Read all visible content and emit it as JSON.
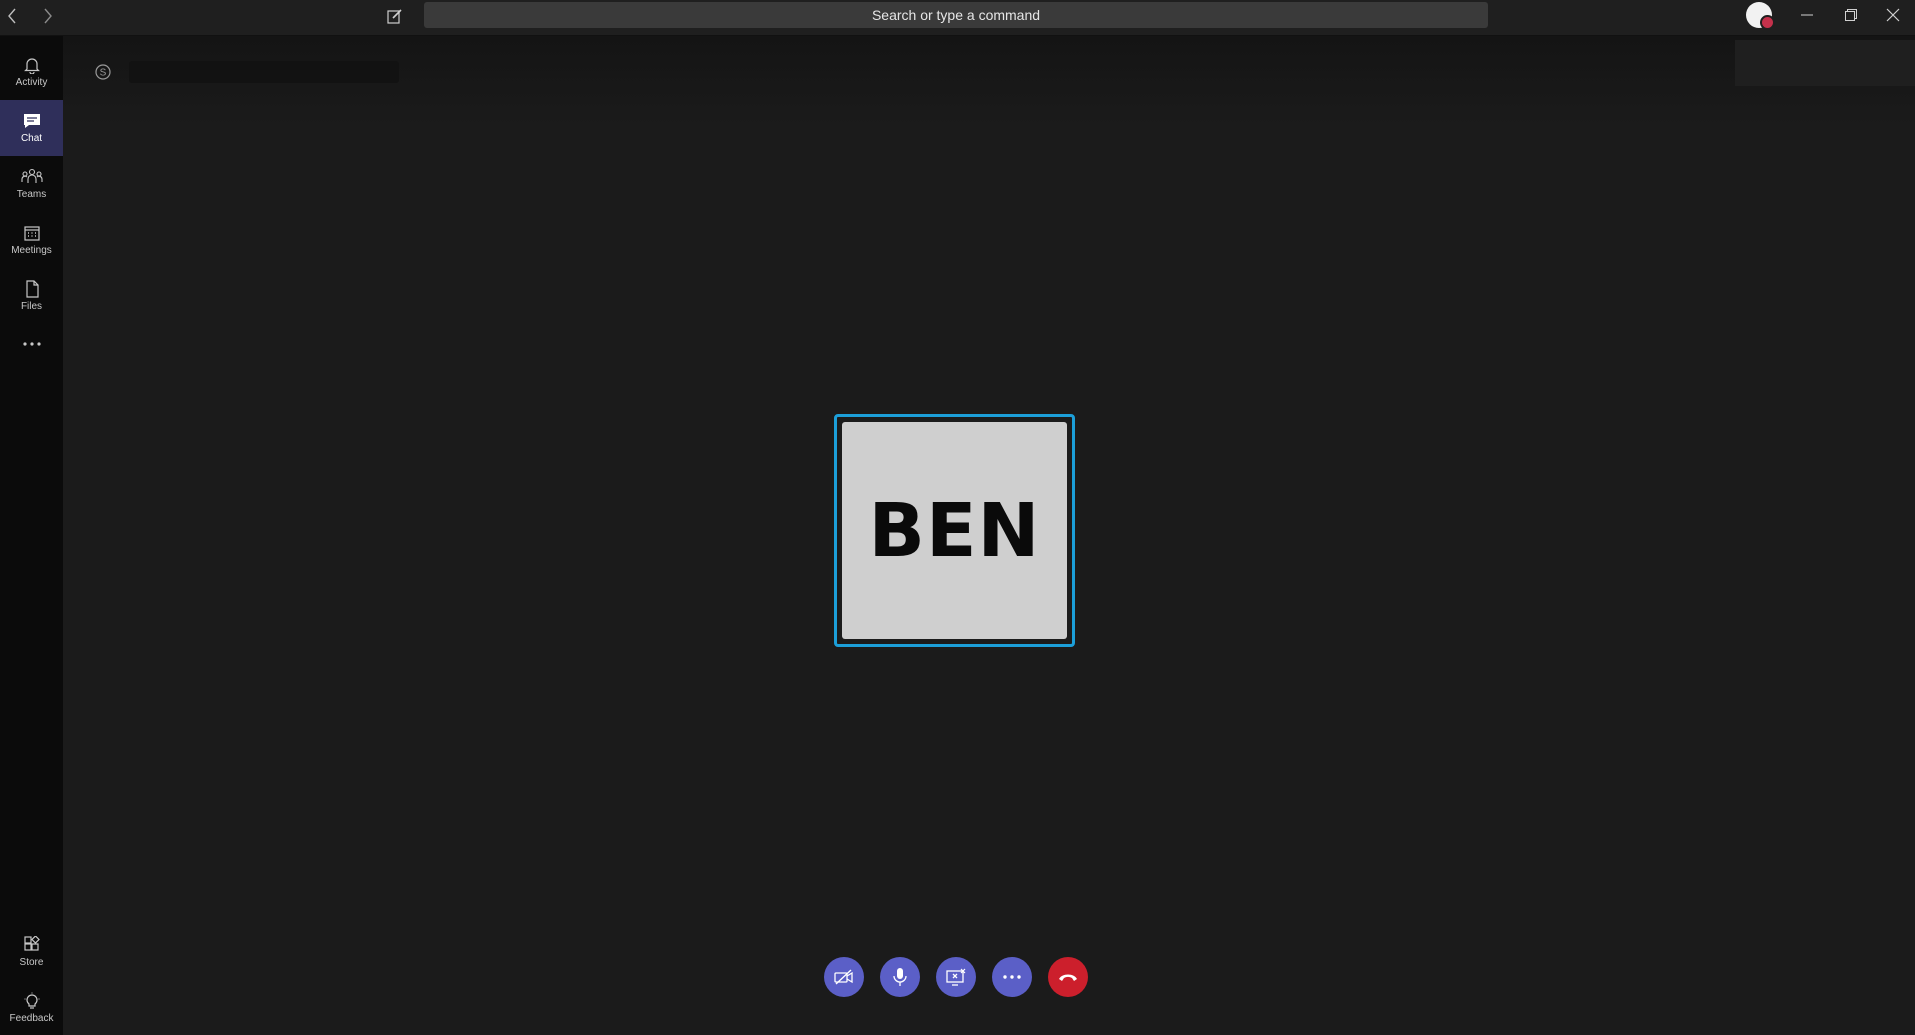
{
  "titlebar": {
    "search_placeholder": "Search or type a command"
  },
  "rail": {
    "items": [
      {
        "label": "Activity",
        "icon": "bell-icon"
      },
      {
        "label": "Chat",
        "icon": "chat-icon",
        "active": true
      },
      {
        "label": "Teams",
        "icon": "teams-icon"
      },
      {
        "label": "Meetings",
        "icon": "calendar-icon"
      },
      {
        "label": "Files",
        "icon": "file-icon"
      }
    ],
    "bottom": [
      {
        "label": "Store",
        "icon": "store-icon"
      },
      {
        "label": "Feedback",
        "icon": "lightbulb-icon"
      }
    ]
  },
  "call": {
    "participant_name": "BEN"
  },
  "colors": {
    "accent": "#5b5fc7",
    "hangup": "#cc1f2c",
    "tile_border": "#1c9fd9",
    "rail_active": "#2f2f5a"
  }
}
